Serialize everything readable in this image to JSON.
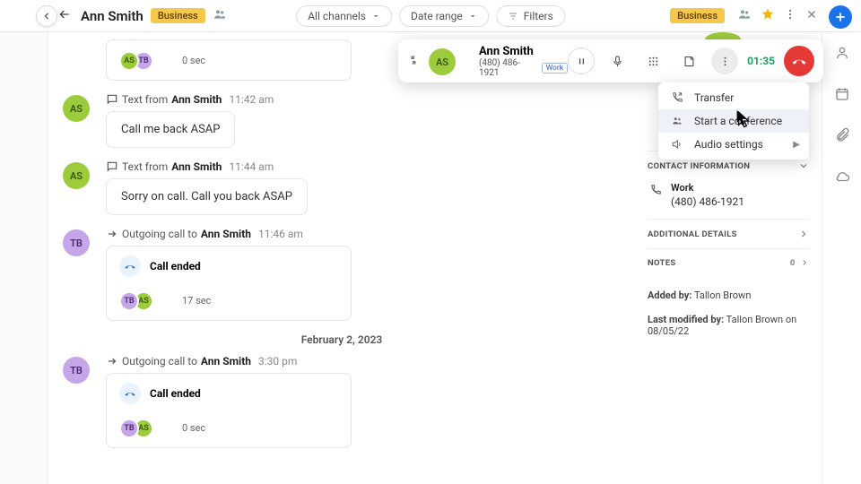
{
  "header": {
    "contact_name": "Ann Smith",
    "tag": "Business"
  },
  "filters": {
    "channels": "All channels",
    "daterange": "Date range",
    "filters": "Filters"
  },
  "timeline": {
    "entries": [
      {
        "type": "callcard_top",
        "duration": "0 sec",
        "av1": "AS",
        "av2": "TB"
      },
      {
        "type": "text",
        "av": "AS",
        "prefix": "Text from",
        "name": "Ann Smith",
        "time": "11:42 am",
        "body": "Call me back ASAP"
      },
      {
        "type": "text",
        "av": "AS",
        "prefix": "Text from",
        "name": "Ann Smith",
        "time": "11:44 am",
        "body": "Sorry on call. Call you back ASAP"
      },
      {
        "type": "call",
        "av": "TB",
        "prefix": "Outgoing call to",
        "name": "Ann Smith",
        "time": "11:46 am",
        "status": "Call ended",
        "duration": "17 sec",
        "av1": "TB",
        "av2": "AS"
      }
    ],
    "date_sep": "February 2, 2023",
    "entries2": [
      {
        "type": "call",
        "av": "TB",
        "prefix": "Outgoing call to",
        "name": "Ann Smith",
        "time": "3:30 pm",
        "status": "Call ended",
        "duration": "0 sec",
        "av1": "TB",
        "av2": "AS"
      }
    ]
  },
  "callbar": {
    "name": "Ann Smith",
    "number": "(480) 486-1921",
    "numlabel": "Work",
    "timer": "01:35"
  },
  "dropdown": {
    "transfer": "Transfer",
    "conference": "Start a conference",
    "audio": "Audio settings"
  },
  "sidepanel": {
    "contact_info_hdr": "CONTACT INFORMATION",
    "work_label": "Work",
    "work_number": "(480) 486-1921",
    "additional_hdr": "ADDITIONAL DETAILS",
    "notes_hdr": "NOTES",
    "notes_count": "0",
    "added_by_lbl": "Added by:",
    "added_by_val": "Tallon Brown",
    "modified_lbl": "Last modified by:",
    "modified_val": "Tallon Brown on 08/05/22"
  }
}
